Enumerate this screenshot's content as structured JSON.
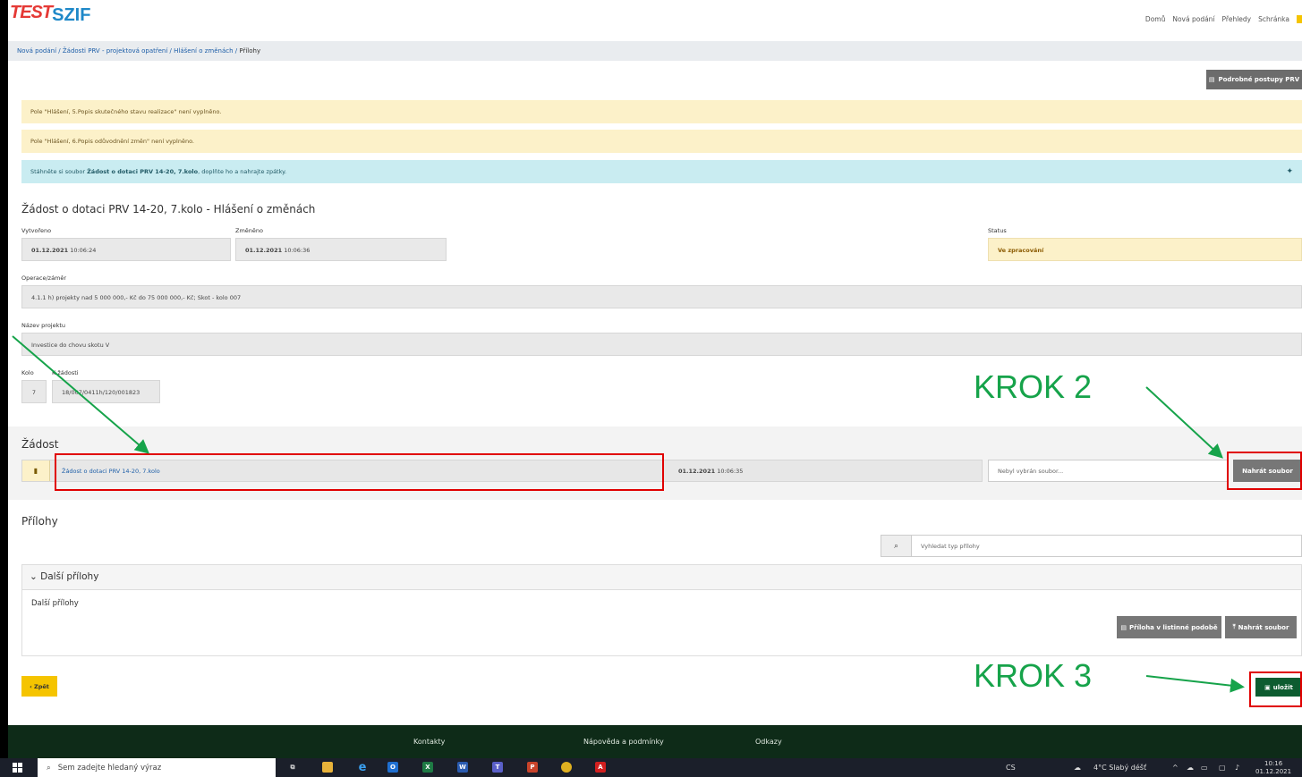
{
  "logo": {
    "test": "TEST",
    "szif": "SZIF"
  },
  "topnav": [
    "Domů",
    "Nová podání",
    "Přehledy",
    "Schránka"
  ],
  "breadcrumb": {
    "items": [
      "Nová podání",
      "Žádosti PRV - projektová opatření",
      "Hlášení o změnách"
    ],
    "sep": "/",
    "current": "Přílohy"
  },
  "postupy_button": "Podrobné postupy PRV",
  "alerts": {
    "warn1": "Pole \"Hlášení, 5.Popis skutečného stavu realizace\" není vyplněno.",
    "warn2": "Pole \"Hlášení, 6.Popis odůvodnění změn\" není vyplněno.",
    "info_prefix": "Stáhněte si soubor ",
    "info_bold": "Žádost o dotaci PRV 14-20, 7.kolo",
    "info_suffix": ", doplňte ho a nahrajte zpátky."
  },
  "title": "Žádost o dotaci PRV 14-20, 7.kolo - Hlášení o změnách",
  "fields": {
    "vytvoreno_label": "Vytvořeno",
    "vytvoreno_date": "01.12.2021",
    "vytvoreno_time": "10:06:24",
    "zmeneno_label": "Změněno",
    "zmeneno_date": "01.12.2021",
    "zmeneno_time": "10:06:36",
    "status_label": "Status",
    "status_value": "Ve zpracování",
    "operace_label": "Operace/záměr",
    "operace_value": "4.1.1 h) projekty nad 5 000 000,- Kč do 75 000 000,- Kč; Skot - kolo 007",
    "nazev_label": "Název projektu",
    "nazev_value": "Investice do chovu skotu V",
    "kolo_label": "Kolo",
    "kolo_value": "7",
    "kzadosti_label": "K žádosti",
    "kzadosti_value": "18/007/0411h/120/001823"
  },
  "zadost": {
    "heading": "Žádost",
    "file_link": "Žádost o dotaci PRV 14-20, 7.kolo",
    "file_date": "01.12.2021",
    "file_time": "10:06:35",
    "file_placeholder": "Nebyl vybrán soubor...",
    "upload_button": "Nahrát soubor"
  },
  "prilohy": {
    "heading": "Přílohy",
    "search_placeholder": "Vyhledat typ přílohy",
    "panel_title": "Další přílohy",
    "panel_body": "Další přílohy",
    "listinna_button": "Příloha v listinné podobě",
    "upload_button": "Nahrát soubor"
  },
  "buttons": {
    "zpet": "Zpět",
    "ulozit": "uložit"
  },
  "footer": [
    "Kontakty",
    "Nápověda a podmínky",
    "Odkazy"
  ],
  "annotations": {
    "krok2": "KROK 2",
    "krok3": "KROK 3"
  },
  "taskbar": {
    "search_placeholder": "Sem zadejte hledaný výraz",
    "lang": "CS",
    "weather": "4°C  Slabý déšť",
    "time": "10:16",
    "date": "01.12.2021"
  },
  "colors": {
    "accent_link": "#1e5fa8",
    "warning_bg": "#fcf1c9",
    "info_bg": "#c9ecf1",
    "save_green": "#0d5c30",
    "annotation_green": "#16a34a",
    "annotation_red": "#e00000",
    "back_yellow": "#f5c400"
  }
}
